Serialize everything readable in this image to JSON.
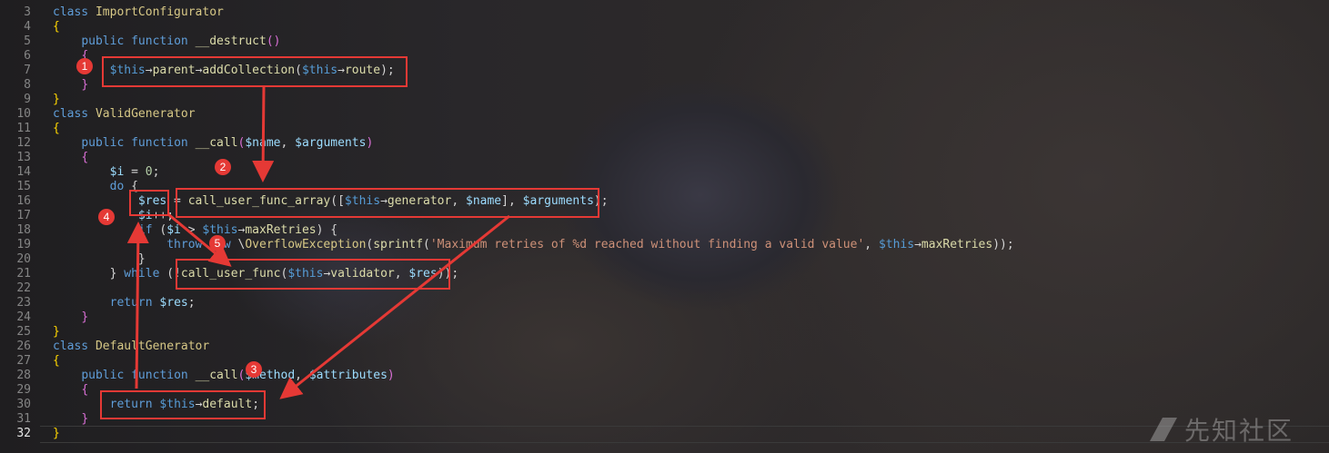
{
  "editor": {
    "lines": [
      {
        "n": "3",
        "html": "<span class='kw'>class</span> <span class='cls'>ImportConfigurator</span>"
      },
      {
        "n": "4",
        "html": "<span class='br'>{</span>"
      },
      {
        "n": "5",
        "html": "    <span class='kw'>public</span> <span class='kw'>function</span> <span class='fn'>__destruct</span><span class='br2'>()</span>"
      },
      {
        "n": "6",
        "html": "    <span class='br2'>{</span>"
      },
      {
        "n": "7",
        "html": "        <span class='this'>$this</span>→<span class='fn'>parent</span>→<span class='fn'>addCollection</span>(<span class='this'>$this</span>→<span class='fn'>route</span>);"
      },
      {
        "n": "8",
        "html": "    <span class='br2'>}</span>"
      },
      {
        "n": "9",
        "html": "<span class='br'>}</span>"
      },
      {
        "n": "10",
        "html": "<span class='kw'>class</span> <span class='cls'>ValidGenerator</span>"
      },
      {
        "n": "11",
        "html": "<span class='br'>{</span>"
      },
      {
        "n": "12",
        "html": "    <span class='kw'>public</span> <span class='kw'>function</span> <span class='fn'>__call</span><span class='br2'>(</span><span class='var'>$name</span>, <span class='var'>$arguments</span><span class='br2'>)</span>"
      },
      {
        "n": "13",
        "html": "    <span class='br2'>{</span>"
      },
      {
        "n": "14",
        "html": "        <span class='var'>$i</span> = <span class='num'>0</span>;"
      },
      {
        "n": "15",
        "html": "        <span class='kw'>do</span> {"
      },
      {
        "n": "16",
        "html": "            <span class='var'>$res</span> = <span class='fn'>call_user_func_array</span>([<span class='this'>$this</span>→<span class='fn'>generator</span>, <span class='var'>$name</span>], <span class='var'>$arguments</span>);"
      },
      {
        "n": "17",
        "html": "            <span class='var'>$i</span>++;"
      },
      {
        "n": "18",
        "html": "            <span class='kw'>if</span> (<span class='var'>$i</span> > <span class='this'>$this</span>→<span class='fn'>maxRetries</span>) {"
      },
      {
        "n": "19",
        "html": "                <span class='kw'>throw</span> <span class='kw'>new</span> \\<span class='cls'>OverflowException</span>(<span class='fn'>sprintf</span>(<span class='str'>'Maximum retries of %d reached without finding a valid value'</span>, <span class='this'>$this</span>→<span class='fn'>maxRetries</span>));"
      },
      {
        "n": "20",
        "html": "            }"
      },
      {
        "n": "21",
        "html": "        } <span class='kw'>while</span> (!<span class='fn'>call_user_func</span>(<span class='this'>$this</span>→<span class='fn'>validator</span>, <span class='var'>$res</span>));"
      },
      {
        "n": "22",
        "html": ""
      },
      {
        "n": "23",
        "html": "        <span class='kw'>return</span> <span class='var'>$res</span>;"
      },
      {
        "n": "24",
        "html": "    <span class='br2'>}</span>"
      },
      {
        "n": "25",
        "html": "<span class='br'>}</span>"
      },
      {
        "n": "26",
        "html": "<span class='kw'>class</span> <span class='cls'>DefaultGenerator</span>"
      },
      {
        "n": "27",
        "html": "<span class='br'>{</span>"
      },
      {
        "n": "28",
        "html": "    <span class='kw'>public</span> <span class='kw'>function</span> <span class='fn'>__call</span><span class='br2'>(</span><span class='var'>$method</span>, <span class='var'>$attributes</span><span class='br2'>)</span>"
      },
      {
        "n": "29",
        "html": "    <span class='br2'>{</span>"
      },
      {
        "n": "30",
        "html": "        <span class='kw'>return</span> <span class='this'>$this</span>→<span class='fn'>default</span>;"
      },
      {
        "n": "31",
        "html": "    <span class='br2'>}</span>"
      },
      {
        "n": "32",
        "html": "<span class='br'>}</span>"
      }
    ],
    "current_line": "32"
  },
  "annotations": {
    "badges": [
      "1",
      "2",
      "3",
      "4",
      "5"
    ],
    "color": "#e53935"
  },
  "watermark": {
    "text": "先知社区"
  }
}
